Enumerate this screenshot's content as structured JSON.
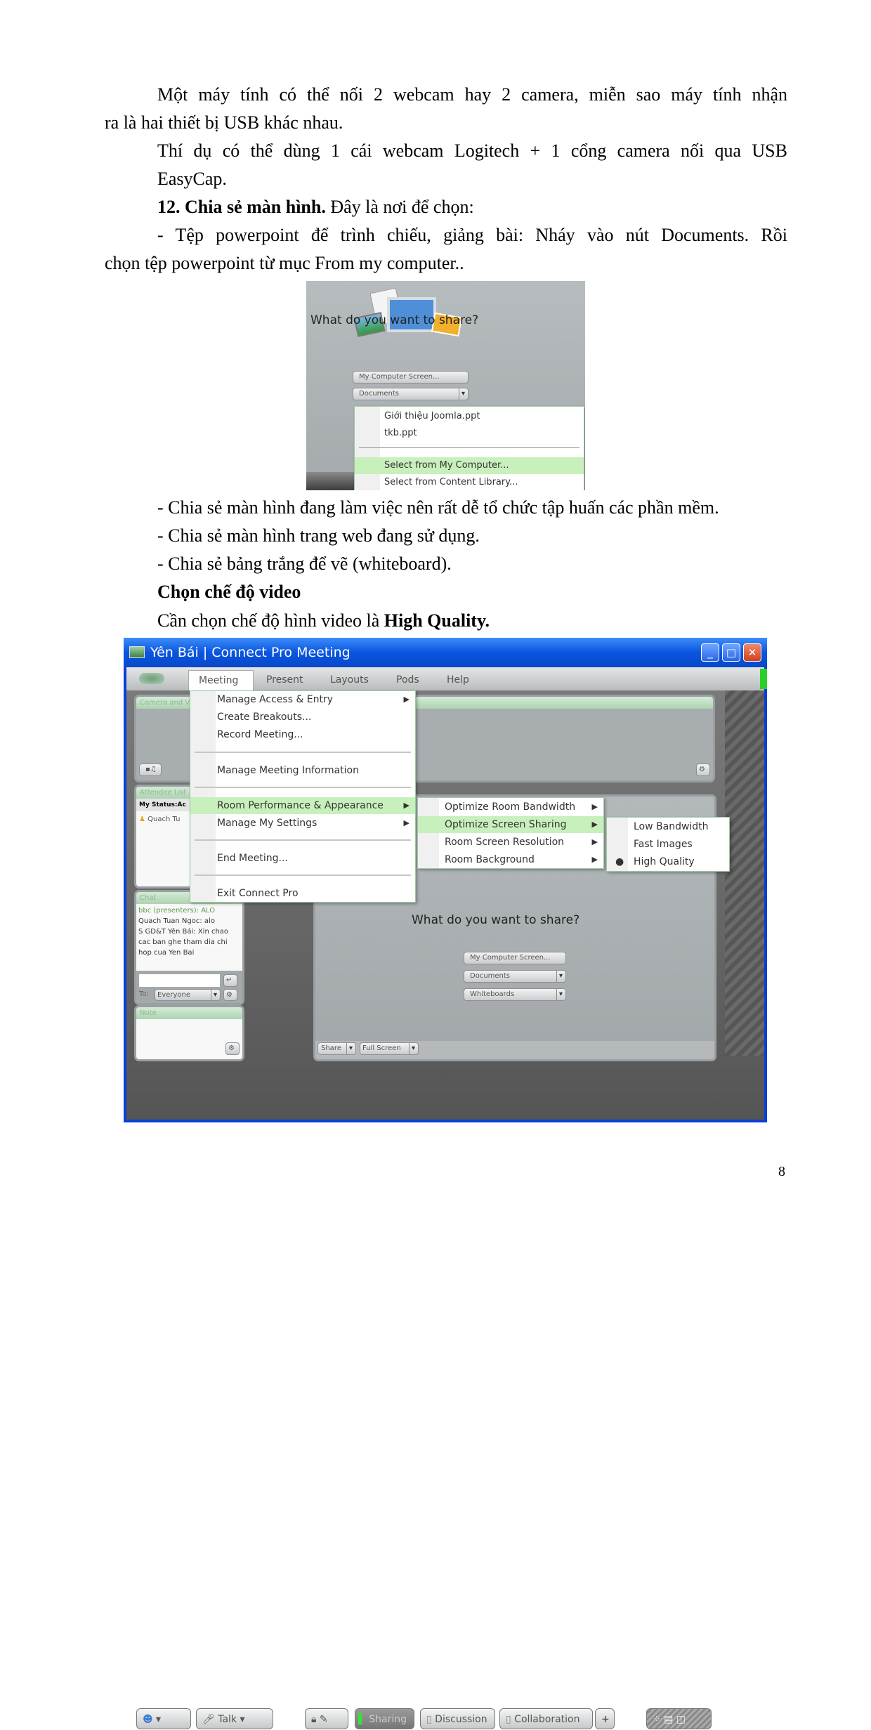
{
  "doc": {
    "para1_line1": "Một máy tính có thể nối 2 webcam hay 2 camera,  miễn sao máy tính nhận",
    "para1_line2": "ra là hai thiết bị USB khác nhau.",
    "para2_line1": "Thí dụ có thể dùng 1 cái webcam Logitech + 1 cổng camera nối qua USB",
    "para2_line2": "EasyCap.",
    "heading12": "12. Chia sẻ màn hình.",
    "heading12_rest": " Đây là nơi để chọn:",
    "bullet1_line1": "- Tệp powerpoint để trình chiếu, giảng bài: Nháy vào nút Documents. Rồi",
    "bullet1_line2": "chọn tệp powerpoint từ mục From my computer..",
    "bullet2": "- Chia sẻ màn hình đang làm việc nên rất dễ tổ chức tập huấn các phần mềm.",
    "bullet3": "- Chia sẻ màn hình trang web đang sử dụng.",
    "bullet4": "- Chia sẻ bảng trắng để vẽ (whiteboard).",
    "heading_video": "Chọn chế độ video",
    "video_text": "Cần chọn chế độ hình video là ",
    "video_bold": "High Quality.",
    "page_number": "8"
  },
  "figure1": {
    "question": "What do you want to share?",
    "btn_screen": "My Computer Screen...",
    "dropdown_documents": "Documents",
    "items": [
      "Giới thiệu Joomla.ppt",
      "tkb.ppt",
      "Select from My Computer...",
      "Select from Content Library..."
    ],
    "highlight_color": "#c8f0bc"
  },
  "window": {
    "title": "Yên Bái | Connect Pro Meeting",
    "menubar": [
      "Meeting",
      "Present",
      "Layouts",
      "Pods",
      "Help"
    ],
    "meeting_menu": [
      "Manage Access & Entry",
      "Create Breakouts...",
      "Record Meeting...",
      "Manage Meeting Information",
      "Room Performance & Appearance",
      "Manage My Settings",
      "End Meeting...",
      "Exit Connect Pro"
    ],
    "room_submenu": [
      "Optimize Room Bandwidth",
      "Optimize Screen Sharing",
      "Room Screen Resolution",
      "Room Background"
    ],
    "sharing_submenu": [
      "Low Bandwidth",
      "Fast Images",
      "High Quality"
    ],
    "selected_sharing": "High Quality",
    "pods": {
      "camera": "Camera and V",
      "attendee": "Attendee List",
      "my_status": "My Status:Ac",
      "attendee_name": "Quach Tu",
      "chat": "Chat",
      "note": "Note"
    },
    "chat_lines": [
      "bbc (presenters): ALO",
      "Quach Tuan Ngoc: alo",
      "S GD&T Yên Bái: Xin chao",
      "cac ban ghe tham dia chi",
      "hop cua Yen  Bai"
    ],
    "chat_to_label": "To:",
    "chat_to_value": "Everyone",
    "share_pod": {
      "question": "What do you want to share?",
      "btn_screen": "My Computer Screen...",
      "documents": "Documents",
      "whiteboards": "Whiteboards",
      "share": "Share",
      "full_screen": "Full Screen"
    },
    "toolbar": {
      "talk": "Talk",
      "sharing": "Sharing",
      "discussion": "Discussion",
      "collaboration": "Collaboration",
      "add": "+"
    },
    "colors": {
      "titlebar": "#0a55e0",
      "menu_highlight": "#c8f0bc"
    }
  }
}
